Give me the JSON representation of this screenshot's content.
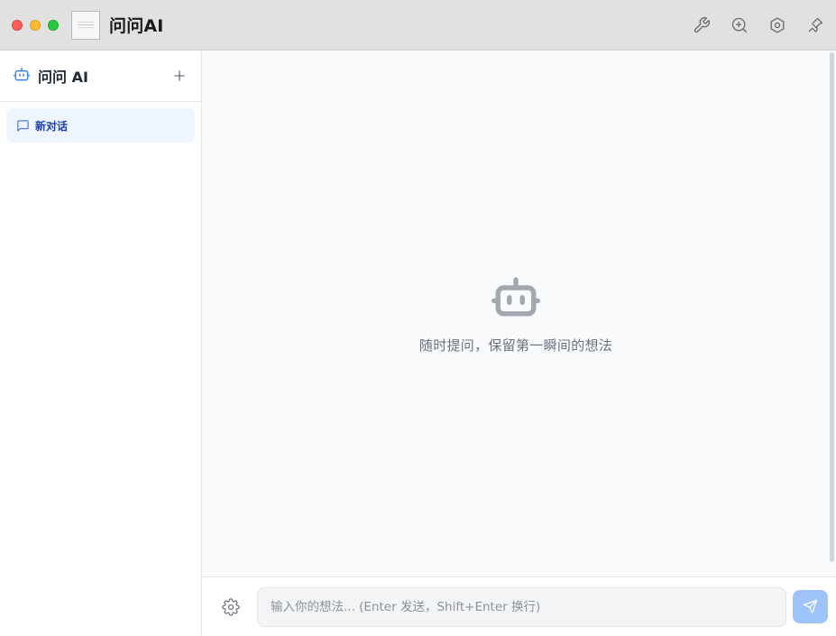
{
  "window": {
    "title": "问问AI",
    "controls": [
      "close",
      "minimize",
      "maximize"
    ],
    "actions": [
      {
        "icon": "wrench-icon"
      },
      {
        "icon": "zoom-in-icon"
      },
      {
        "icon": "hexagon-settings-icon"
      },
      {
        "icon": "pin-icon"
      }
    ]
  },
  "sidebar": {
    "icon": "bot-icon",
    "title": "问问 AI",
    "add_icon": "plus-icon",
    "conversations": [
      {
        "label": "新对话",
        "icon": "chat-bubble-icon",
        "active": true
      }
    ]
  },
  "main": {
    "empty_icon": "bot-icon",
    "empty_text": "随时提问，保留第一瞬间的想法"
  },
  "composer": {
    "settings_icon": "gear-icon",
    "placeholder": "输入你的想法... (Enter 发送，Shift+Enter 换行)",
    "value": "",
    "send_icon": "send-icon"
  },
  "colors": {
    "accent": "#3b82f6",
    "active_item_bg": "#eff5ff",
    "send_button": "#9ec3fb",
    "titlebar": "#e1e1e1"
  }
}
